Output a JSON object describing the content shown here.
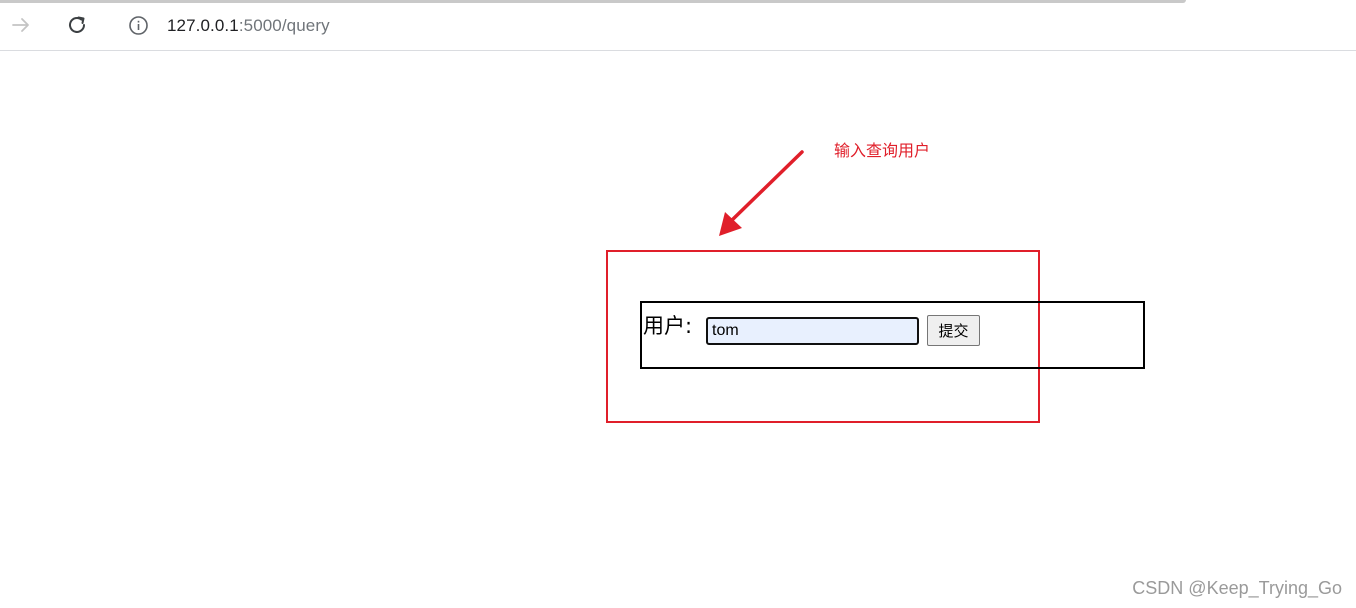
{
  "browser": {
    "url_host": "127.0.0.1",
    "url_rest": ":5000/query",
    "icons": {
      "forward": "forward-arrow-icon",
      "reload": "reload-icon",
      "info": "info-icon"
    }
  },
  "form": {
    "label": "用户:",
    "input_value": "tom",
    "submit_label": "提交"
  },
  "annotation": {
    "text": "输入查询用户",
    "color": "#e01f2a"
  },
  "watermark": "CSDN @Keep_Trying_Go"
}
